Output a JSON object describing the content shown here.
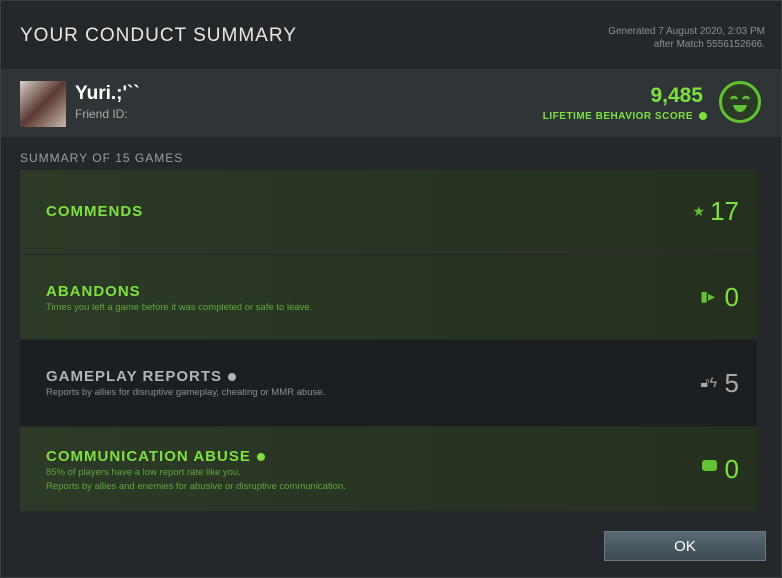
{
  "header": {
    "title": "YOUR CONDUCT SUMMARY",
    "generated_line1": "Generated 7 August 2020, 2:03 PM",
    "generated_line2": "after Match 5556152666."
  },
  "profile": {
    "name": "Yuri.;'``",
    "friend_id_label": "Friend ID:",
    "score": "9,485",
    "score_label": "LIFETIME BEHAVIOR SCORE"
  },
  "summary": {
    "heading": "SUMMARY OF 15 GAMES",
    "rows": [
      {
        "title": "COMMENDS",
        "desc": "",
        "value": "17",
        "icon": "star-icon"
      },
      {
        "title": "ABANDONS",
        "desc": "Times you left a game before it was completed or safe to leave.",
        "value": "0",
        "icon": "exit-door-icon"
      },
      {
        "title": "GAMEPLAY REPORTS",
        "desc": "Reports by allies for disruptive gameplay, cheating or MMR abuse.",
        "value": "5",
        "icon": "lock-lightning-icon"
      },
      {
        "title": "COMMUNICATION ABUSE",
        "desc": "85% of players have a low report rate like you.",
        "desc2": "Reports by allies and enemies for abusive or disruptive communication.",
        "value": "0",
        "icon": "chat-bubble-icon"
      }
    ]
  },
  "ok_label": "OK",
  "colors": {
    "accent": "#7ee040",
    "neutral": "#aaaaaa"
  }
}
